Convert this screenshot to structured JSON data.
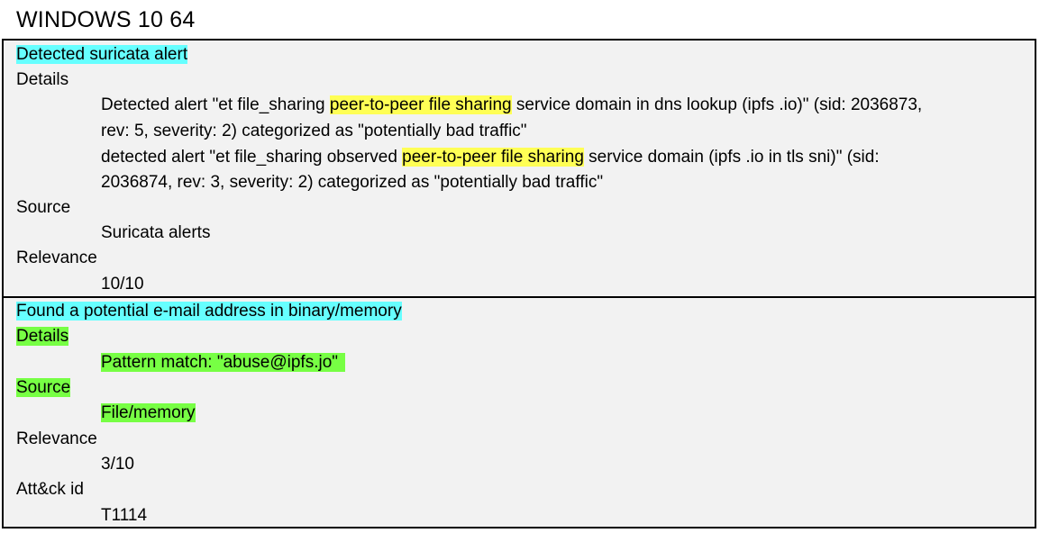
{
  "page_title": "WINDOWS 10 64",
  "finding1": {
    "heading": "Detected suricata alert",
    "details_label": "Details",
    "alert1": {
      "pre": "Detected alert \"et file_sharing ",
      "highlight": "peer-to-peer file sharing",
      "post": " service domain in dns lookup (ipfs .io)\" (sid: 2036873,",
      "line2": "rev: 5, severity: 2) categorized as \"potentially bad traffic\""
    },
    "alert2": {
      "pre": "detected alert \"et file_sharing observed ",
      "highlight": "peer-to-peer file sharing",
      "post": " service domain (ipfs .io in tls sni)\" (sid:",
      "line2": "2036874, rev: 3, severity: 2) categorized as \"potentially bad traffic\""
    },
    "source_label": "Source",
    "source_value": "Suricata alerts",
    "relevance_label": "Relevance",
    "relevance_value": "10/10"
  },
  "finding2": {
    "heading": "Found a potential e-mail address in binary/memory",
    "details_label": "Details",
    "details_value": "Pattern match: \"abuse@ipfs.jo\"",
    "source_label": "Source",
    "source_value": "File/memory",
    "relevance_label": "Relevance",
    "relevance_value": "3/10",
    "attck_label": "Att&ck id",
    "attck_value": "T1114"
  },
  "colors": {
    "heading_highlight": "#66ffff",
    "term_highlight": "#ffff55",
    "match_highlight": "#77ff44",
    "panel_background": "#f2f2f2"
  }
}
